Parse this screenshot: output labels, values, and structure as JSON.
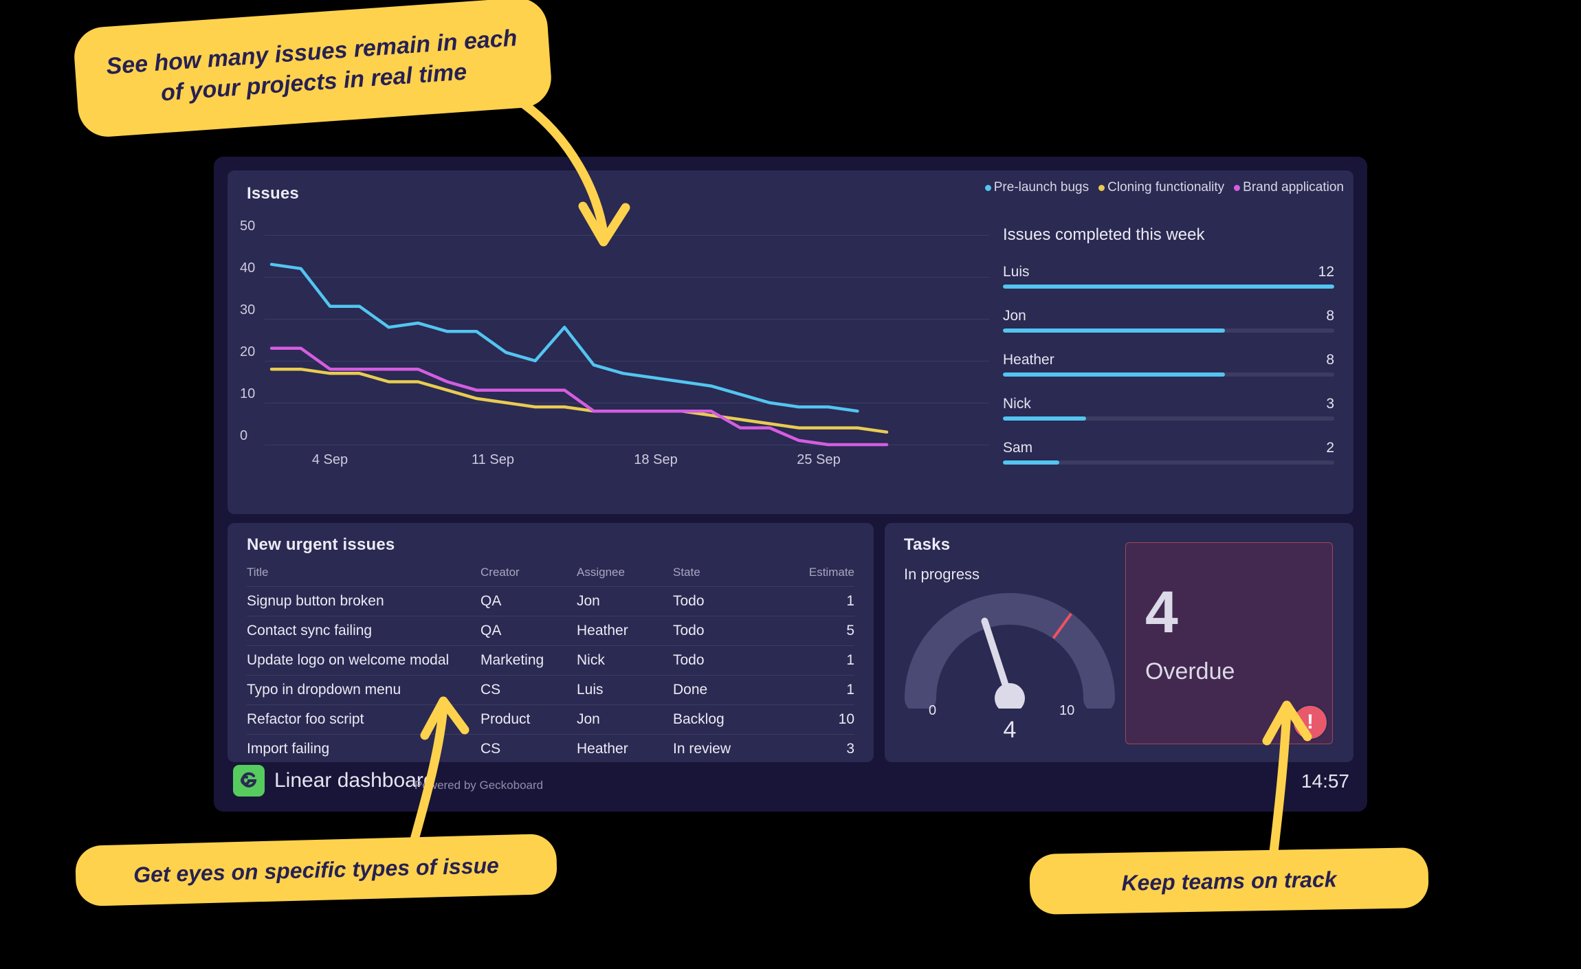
{
  "callouts": [
    {
      "id": "callout-1",
      "text": "See how many issues remain in each of your projects in real time"
    },
    {
      "id": "callout-2",
      "text": "Get eyes on specific types of issue"
    },
    {
      "id": "callout-3",
      "text": "Keep teams on track"
    }
  ],
  "issues_panel": {
    "title": "Issues",
    "legend": [
      {
        "label": "Pre-launch bugs",
        "color": "#53c5f0"
      },
      {
        "label": "Cloning functionality",
        "color": "#e8cc52"
      },
      {
        "label": "Brand application",
        "color": "#d45de0"
      }
    ]
  },
  "chart_data": {
    "type": "line",
    "title": "Issues",
    "xlabel": "",
    "ylabel": "",
    "ylim": [
      0,
      50
    ],
    "yticks": [
      "0",
      "10",
      "20",
      "30",
      "40",
      "50"
    ],
    "xticks": [
      "4 Sep",
      "11 Sep",
      "18 Sep",
      "25 Sep"
    ],
    "grid": true,
    "legend_position": "top-right",
    "x": [
      1,
      2,
      3,
      4,
      5,
      6,
      7,
      8,
      9,
      10,
      11,
      12,
      13,
      14,
      15,
      16,
      17,
      18,
      19,
      20,
      21,
      22
    ],
    "series": [
      {
        "name": "Pre-launch bugs",
        "color": "#53c5f0",
        "values": [
          43,
          42,
          33,
          33,
          28,
          29,
          27,
          27,
          22,
          20,
          28,
          19,
          17,
          16,
          15,
          14,
          12,
          10,
          9,
          9,
          8,
          null
        ]
      },
      {
        "name": "Cloning functionality",
        "color": "#e8cc52",
        "values": [
          18,
          18,
          17,
          17,
          15,
          15,
          13,
          11,
          10,
          9,
          9,
          8,
          8,
          8,
          8,
          7,
          6,
          5,
          4,
          4,
          4,
          3
        ]
      },
      {
        "name": "Brand application",
        "color": "#d45de0",
        "values": [
          23,
          23,
          18,
          18,
          18,
          18,
          15,
          13,
          13,
          13,
          13,
          8,
          8,
          8,
          8,
          8,
          4,
          4,
          1,
          0,
          0,
          0
        ]
      }
    ]
  },
  "completed": {
    "title": "Issues completed this week",
    "max": 12,
    "rows": [
      {
        "name": "Luis",
        "value": "12",
        "pct": 100
      },
      {
        "name": "Jon",
        "value": "8",
        "pct": 67
      },
      {
        "name": "Heather",
        "value": "8",
        "pct": 67
      },
      {
        "name": "Nick",
        "value": "3",
        "pct": 25
      },
      {
        "name": "Sam",
        "value": "2",
        "pct": 17
      }
    ]
  },
  "urgent": {
    "title": "New urgent issues",
    "columns": [
      "Title",
      "Creator",
      "Assignee",
      "State",
      "Estimate"
    ],
    "rows": [
      {
        "title": "Signup button broken",
        "creator": "QA",
        "assignee": "Jon",
        "state": "Todo",
        "estimate": "1"
      },
      {
        "title": "Contact sync failing",
        "creator": "QA",
        "assignee": "Heather",
        "state": "Todo",
        "estimate": "5"
      },
      {
        "title": "Update logo on welcome modal",
        "creator": "Marketing",
        "assignee": "Nick",
        "state": "Todo",
        "estimate": "1"
      },
      {
        "title": "Typo in dropdown menu",
        "creator": "CS",
        "assignee": "Luis",
        "state": "Done",
        "estimate": "1"
      },
      {
        "title": "Refactor foo script",
        "creator": "Product",
        "assignee": "Jon",
        "state": "Backlog",
        "estimate": "10"
      },
      {
        "title": "Import failing",
        "creator": "CS",
        "assignee": "Heather",
        "state": "In review",
        "estimate": "3"
      }
    ]
  },
  "tasks": {
    "title": "Tasks",
    "gauge": {
      "label": "In progress",
      "min": "0",
      "max": "10",
      "value": "4",
      "threshold": 7
    },
    "overdue": {
      "value": "4",
      "label": "Overdue"
    },
    "alert_icon": "exclamation-icon"
  },
  "footer": {
    "logo_icon": "geckoboard-logo-icon",
    "brand": "Linear dashboard",
    "powered": "Powered by Geckoboard",
    "time": "14:57"
  }
}
